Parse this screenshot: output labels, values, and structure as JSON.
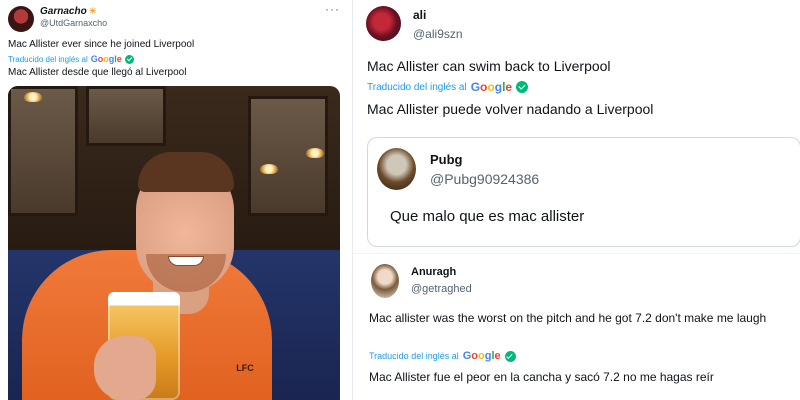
{
  "left_tweet": {
    "author_name": "Garnacho",
    "author_badge": "☀",
    "author_handle": "@UtdGarnaxcho",
    "more": "···",
    "text": "Mac Allister ever since he joined Liverpool",
    "translated_label": "Traducido del inglés al",
    "translation": "Mac Allister desde que llegó al Liverpool"
  },
  "reply_tweet": {
    "author_name": "ali",
    "author_handle": "@ali9szn",
    "text": "Mac Allister can swim back to Liverpool",
    "translated_label": "Traducido del inglés al",
    "translation": "Mac Allister puede volver nadando a Liverpool"
  },
  "quoted_tweet": {
    "author_name": "Pubg",
    "author_handle": "@Pubg90924386",
    "text": "Que malo que es mac allister"
  },
  "anuragh_tweet": {
    "author_name": "Anuragh",
    "author_handle": "@getraghed",
    "text": "Mac allister was the worst on the pitch and he got 7.2 don't make me laugh",
    "translated_label": "Traducido del inglés al",
    "translation": "Mac Allister fue el peor en la cancha y sacó 7.2 no me hagas reír"
  },
  "google": {
    "b": "G",
    "o1": "o",
    "o2": "o",
    "g": "g",
    "l": "l",
    "e": "e"
  },
  "photo": {
    "crest_text": "LFC"
  },
  "colors": {
    "link": "#1d9bf0",
    "verified": "#00ba7c",
    "jersey": "#f07a3a"
  }
}
